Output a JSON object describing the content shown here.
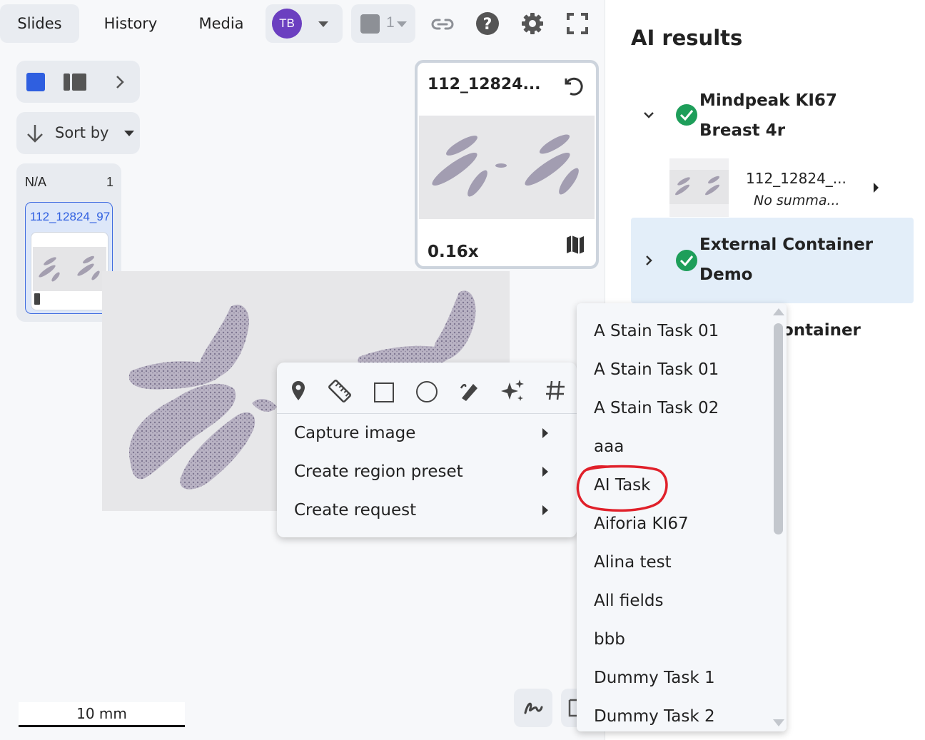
{
  "toolbar": {
    "tabs": [
      {
        "label": "Slides"
      },
      {
        "label": "History"
      },
      {
        "label": "Media"
      }
    ],
    "avatar_initials": "TB",
    "layer_count": "1"
  },
  "left": {
    "sort_label": "Sort by",
    "group_label": "N/A",
    "group_count": "1",
    "slide_name": "112_12824_97"
  },
  "thumbnail": {
    "title": "112_12824...",
    "zoom": "0.16x"
  },
  "scale_bar": "10 mm",
  "ai_results": {
    "title": "AI results",
    "results": [
      {
        "name": "Mindpeak KI67 Breast 4r",
        "expanded": true,
        "slide": {
          "name": "112_12824_...",
          "summary": "No summa..."
        }
      },
      {
        "name": "External Container Demo",
        "expanded": false,
        "highlighted": true
      },
      {
        "name": "ontainer",
        "partial": true
      }
    ]
  },
  "context_menu": {
    "tools": [
      "pin-icon",
      "ruler-icon",
      "rectangle-icon",
      "circle-icon",
      "brush-icon",
      "ai-sparkle-icon",
      "hash-icon"
    ],
    "items": [
      {
        "label": "Capture image"
      },
      {
        "label": "Create region preset"
      },
      {
        "label": "Create request"
      }
    ]
  },
  "task_list": {
    "items": [
      {
        "label": "A Stain Task 01"
      },
      {
        "label": "A Stain Task 01"
      },
      {
        "label": "A Stain Task 02"
      },
      {
        "label": "aaa"
      },
      {
        "label": "AI Task",
        "circled": true
      },
      {
        "label": "Aiforia KI67"
      },
      {
        "label": "Alina test"
      },
      {
        "label": "All fields"
      },
      {
        "label": "bbb"
      },
      {
        "label": "Dummy Task 1"
      },
      {
        "label": "Dummy Task 2"
      }
    ],
    "annotation_color": "#e0202a"
  },
  "colors": {
    "accent": "#2f5fe0",
    "avatar": "#6b3fc0",
    "success": "#1e9e5a",
    "highlight": "#e3eef9"
  }
}
